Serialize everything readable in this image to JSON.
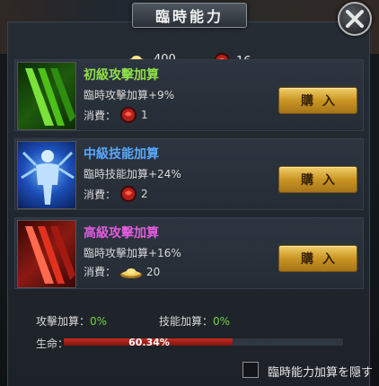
{
  "title": "臨時能力",
  "currency": {
    "gold": "400",
    "gem": "16"
  },
  "items": [
    {
      "name": "初級攻擊加算",
      "name_color": "#8fe04a",
      "effect": "臨時攻擊加算+9%",
      "cost_label": "消費：",
      "cost_icon": "red-gem-icon",
      "cost_value": "1",
      "buy_label": "購入"
    },
    {
      "name": "中級技能加算",
      "name_color": "#58a8ff",
      "effect": "臨時技能加算+24%",
      "cost_label": "消費：",
      "cost_icon": "red-gem-icon",
      "cost_value": "2",
      "buy_label": "購入"
    },
    {
      "name": "高級攻擊加算",
      "name_color": "#e45be0",
      "effect": "臨時攻擊加算+16%",
      "cost_label": "消費：",
      "cost_icon": "gold-ingot-icon",
      "cost_value": "20",
      "buy_label": "購入"
    }
  ],
  "stats": {
    "attack_label": "攻擊加算：",
    "attack_value": "0%",
    "skill_label": "技能加算：",
    "skill_value": "0%",
    "life_label": "生命：",
    "life_text": "60.34%",
    "life_fraction": 0.6034
  },
  "hide_label": "臨時能力加算を隠す",
  "colors": {
    "positive": "#6fd43f",
    "life_bar": "#c52a20",
    "button_gold": "#d9a53a"
  }
}
